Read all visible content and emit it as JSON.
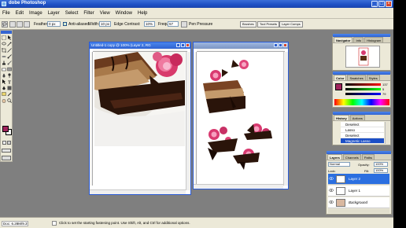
{
  "window": {
    "title": "dobe Photoshop"
  },
  "menu": [
    "File",
    "Edit",
    "Image",
    "Layer",
    "Select",
    "Filter",
    "View",
    "Window",
    "Help"
  ],
  "options": {
    "feather_label": "Feather:",
    "feather_value": "0 px",
    "antialiased_label": "Anti-aliased",
    "width_label": "Width:",
    "width_value": "10 px",
    "edge_contrast_label": "Edge Contrast:",
    "edge_contrast_value": "10%",
    "frequency_label": "Frequency:",
    "frequency_value": "57",
    "pen_pressure_label": "Pen Pressure",
    "palette_tabs": [
      "Brushes",
      "Tool Presets",
      "Layer Comps"
    ]
  },
  "documents": [
    {
      "title": "Untitled-1 copy @ 100% (Layer 2, RG"
    },
    {
      "title": ""
    }
  ],
  "panels": {
    "navigator": {
      "tabs": [
        "Navigator",
        "Info",
        "Histogram"
      ]
    },
    "color": {
      "tabs": [
        "Color",
        "Swatches",
        "Styles"
      ],
      "r": "137",
      "g": "5",
      "b": "79"
    },
    "history": {
      "tabs": [
        "History",
        "Actions"
      ],
      "items": [
        "Deselect",
        "Lasso",
        "Deselect",
        "Magnetic Lasso"
      ],
      "selected_index": 3
    },
    "layers": {
      "tabs": [
        "Layers",
        "Channels",
        "Paths"
      ],
      "blend_mode": "Normal",
      "opacity_label": "Opacity:",
      "opacity_value": "100%",
      "lock_label": "Lock:",
      "fill_label": "Fill:",
      "fill_value": "100%",
      "layers": [
        "Layer 2",
        "Layer 1",
        "Background"
      ],
      "selected_index": 0
    }
  },
  "status": {
    "doc": "Doc: 6.28M/9.37M",
    "message": "Click to set the starting fastening point.  Use Shift, Alt, and Ctrl for additional options."
  },
  "colors": {
    "title_blue": "#1d4fc4",
    "chrome": "#ece9d8",
    "workspace": "#7f7f7f",
    "foreground_swatch": "#a0245c",
    "selection": "#1c4fc6"
  },
  "icons": [
    "photoshop-icon",
    "lasso-icon",
    "eye-icon",
    "move-icon",
    "marquee-icon",
    "brush-icon",
    "type-icon",
    "zoom-icon",
    "hand-icon"
  ]
}
